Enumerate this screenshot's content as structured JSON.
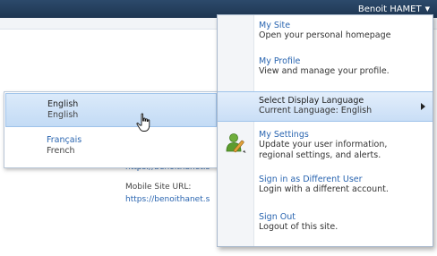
{
  "topbar": {
    "user_name": "Benoit HAMET",
    "caret": "▼"
  },
  "background": {
    "url_line_1": "https://benoithanet.s",
    "mobile_label": "Mobile Site URL:",
    "url_line_2": "https://benoithanet.s"
  },
  "language_flyout": {
    "items": [
      {
        "native": "English",
        "english": "English",
        "selected": true
      },
      {
        "native": "Français",
        "english": "French",
        "selected": false
      }
    ]
  },
  "user_menu": {
    "items": [
      {
        "title": "My Site",
        "desc": "Open your personal homepage"
      },
      {
        "title": "My Profile",
        "desc": "View and manage your profile."
      },
      {
        "title": "Select Display Language",
        "desc": "Current Language: English"
      },
      {
        "title": "My Settings",
        "desc_1": "Update your user information,",
        "desc_2": "regional settings, and alerts."
      },
      {
        "title": "Sign in as Different User",
        "desc": "Login with a different account."
      },
      {
        "title": "Sign Out",
        "desc": "Logout of this site."
      }
    ]
  },
  "icons": {
    "settings": "user-settings-icon",
    "cursor": "hand-pointer-icon",
    "submenu": "submenu-arrow-icon"
  }
}
